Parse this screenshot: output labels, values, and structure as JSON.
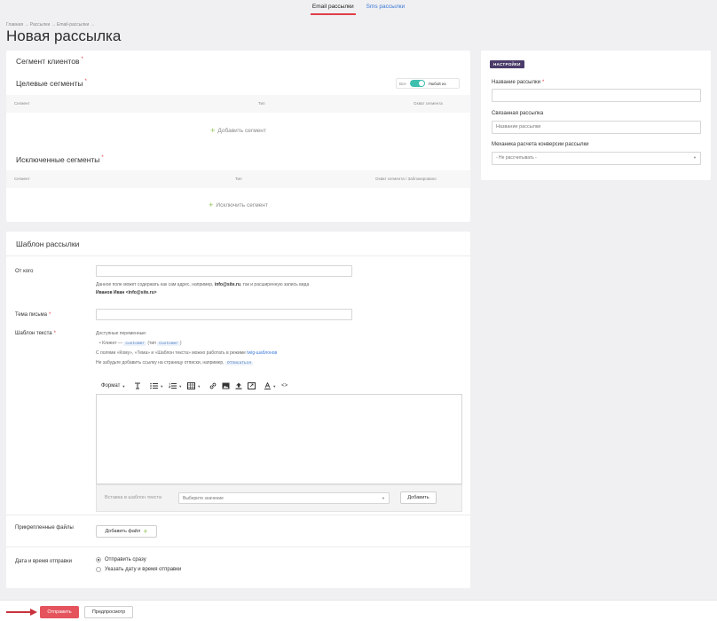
{
  "tabs": [
    {
      "label": "Email рассылки",
      "active": true
    },
    {
      "label": "Sms рассылки",
      "active": false
    }
  ],
  "breadcrumb": "Главная → Рассылки → Email-рассылки →",
  "page_title": "Новая рассылка",
  "segments": {
    "title": "Сегмент клиентов",
    "target_title": "Целевые сегменты",
    "toggle_all": "Все",
    "toggle_any": "Любой из",
    "target_columns": [
      "Сегмент",
      "Тип",
      "Охват сегмента"
    ],
    "add_segment": "Добавить сегмент",
    "excluded_title": "Исключенные сегменты",
    "excluded_columns": [
      "Сегмент",
      "Тип",
      "Охват сегмента / Заблокировано"
    ],
    "exclude_segment": "Исключить сегмент"
  },
  "template": {
    "title": "Шаблон рассылки",
    "from_label": "От кого",
    "from_value": "",
    "from_hint_1": "Данное поле может содержать как сам адрес, например,",
    "from_hint_email": "info@site.ru",
    "from_hint_2": ", так и расширенную запись вида",
    "from_hint_ext": "Иванов Иван <info@site.ru>",
    "subject_label": "Тема письма",
    "subject_value": "",
    "text_label": "Шаблон текста",
    "vars_title": "Доступные переменные:",
    "var_client": "Клиент —",
    "var_client_code": "customer",
    "var_client_type_pre": "(тип",
    "var_client_type": "Customer",
    "var_client_type_post": ")",
    "mode_hint_1": "С полями «Кому», «Тема» и «Шаблон текста» можно работать в режиме",
    "mode_hint_link": "twig-шаблонов",
    "unsub_hint": "Не забудьте добавить ссылку на страницу отписки, например,",
    "unsub_code": "Отписаться",
    "toolbar_format": "Формат",
    "insert_label": "Вставка в шаблон текста",
    "insert_placeholder": "Выберите значение",
    "insert_button": "Добавить",
    "files_label": "Прикрепленные файлы",
    "add_file": "Добавить файл",
    "datetime_label": "Дата и время отправки",
    "send_now": "Отправить сразу",
    "send_later": "Указать дату и время отправки"
  },
  "settings": {
    "badge": "НАСТРОЙКИ",
    "name_label": "Название рассылки",
    "name_value": "",
    "linked_label": "Связанная рассылка",
    "linked_placeholder": "Название рассылки",
    "mechanic_label": "Механика расчета конверсии рассылки",
    "mechanic_value": "- Не рассчитывать -"
  },
  "footer": {
    "send": "Отправить",
    "preview": "Предпросмотр"
  },
  "colors": {
    "accent": "#e5545d",
    "toggle": "#3fbfae",
    "badge": "#4b3c6a",
    "plus": "#8cc14c",
    "link": "#3a7ad8"
  }
}
